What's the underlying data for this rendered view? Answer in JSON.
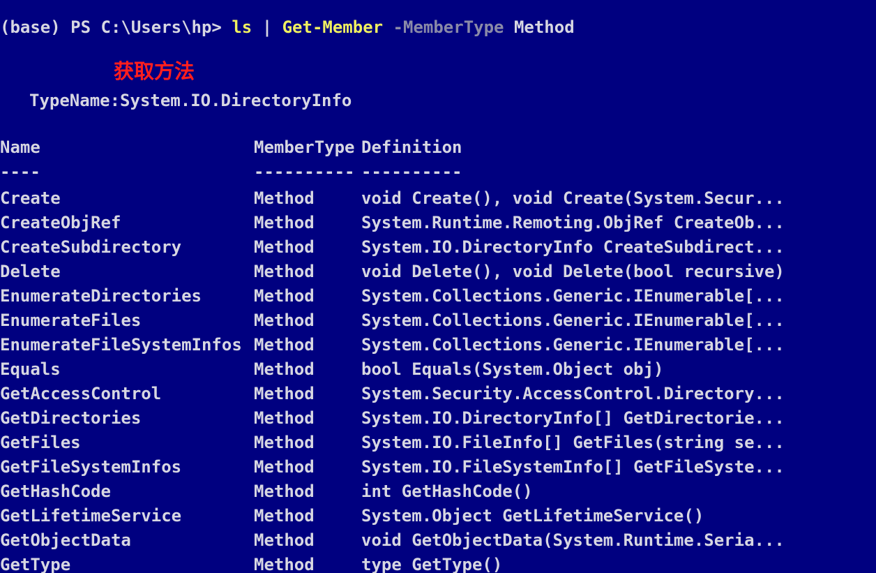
{
  "prompt": {
    "prefix": "(base) PS C:\\Users\\hp> ",
    "command": "ls",
    "pipe": " | ",
    "cmdlet": "Get-Member",
    "parameter": " -MemberType",
    "argument": " Method",
    "colors": {
      "command": "#f0f060",
      "parameter": "#8a8aa8",
      "text": "#d7d7e2",
      "background": "#000080"
    }
  },
  "annotation": {
    "text": "获取方法",
    "color": "#ff1e1e"
  },
  "typename": "TypeName:System.IO.DirectoryInfo",
  "table": {
    "headers": {
      "name": "Name",
      "member_type": "MemberType",
      "definition": "Definition"
    },
    "separators": {
      "name": "----",
      "member_type": "----------",
      "definition": "----------"
    },
    "rows": [
      {
        "name": "Create",
        "member_type": "Method",
        "definition": "void Create(), void Create(System.Secur..."
      },
      {
        "name": "CreateObjRef",
        "member_type": "Method",
        "definition": "System.Runtime.Remoting.ObjRef CreateOb..."
      },
      {
        "name": "CreateSubdirectory",
        "member_type": "Method",
        "definition": "System.IO.DirectoryInfo CreateSubdirect..."
      },
      {
        "name": "Delete",
        "member_type": "Method",
        "definition": "void Delete(), void Delete(bool recursive)"
      },
      {
        "name": "EnumerateDirectories",
        "member_type": "Method",
        "definition": "System.Collections.Generic.IEnumerable[..."
      },
      {
        "name": "EnumerateFiles",
        "member_type": "Method",
        "definition": "System.Collections.Generic.IEnumerable[..."
      },
      {
        "name": "EnumerateFileSystemInfos",
        "member_type": "Method",
        "definition": "System.Collections.Generic.IEnumerable[..."
      },
      {
        "name": "Equals",
        "member_type": "Method",
        "definition": "bool Equals(System.Object obj)"
      },
      {
        "name": "GetAccessControl",
        "member_type": "Method",
        "definition": "System.Security.AccessControl.Directory..."
      },
      {
        "name": "GetDirectories",
        "member_type": "Method",
        "definition": "System.IO.DirectoryInfo[] GetDirectorie..."
      },
      {
        "name": "GetFiles",
        "member_type": "Method",
        "definition": "System.IO.FileInfo[] GetFiles(string se..."
      },
      {
        "name": "GetFileSystemInfos",
        "member_type": "Method",
        "definition": "System.IO.FileSystemInfo[] GetFileSyste..."
      },
      {
        "name": "GetHashCode",
        "member_type": "Method",
        "definition": "int GetHashCode()"
      },
      {
        "name": "GetLifetimeService",
        "member_type": "Method",
        "definition": "System.Object GetLifetimeService()"
      },
      {
        "name": "GetObjectData",
        "member_type": "Method",
        "definition": "void GetObjectData(System.Runtime.Seria..."
      },
      {
        "name": "GetType",
        "member_type": "Method",
        "definition": "type GetType()"
      }
    ]
  }
}
